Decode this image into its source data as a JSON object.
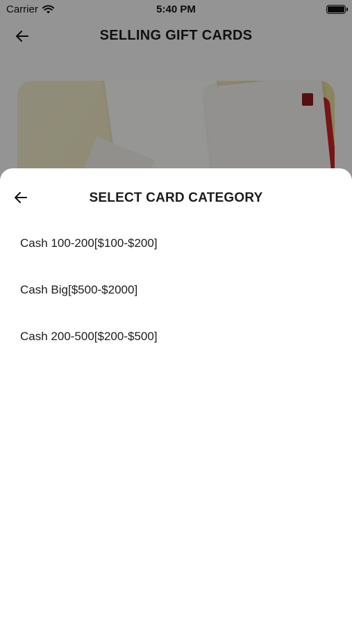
{
  "status_bar": {
    "carrier": "Carrier",
    "time": "5:40 PM",
    "icons": [
      "wifi-icon",
      "battery-icon"
    ]
  },
  "header": {
    "back_icon": "arrow-left-icon",
    "title": "SELLING GIFT CARDS"
  },
  "sheet": {
    "back_icon": "arrow-left-icon",
    "title": "SELECT CARD CATEGORY",
    "categories": [
      {
        "label": "Cash 100-200[$100-$200]"
      },
      {
        "label": "Cash Big[$500-$2000]"
      },
      {
        "label": "Cash 200-500[$200-$500]"
      }
    ]
  },
  "colors": {
    "overlay": "#000000",
    "text": "#1c1c1e",
    "card_red": "#c8262c"
  }
}
